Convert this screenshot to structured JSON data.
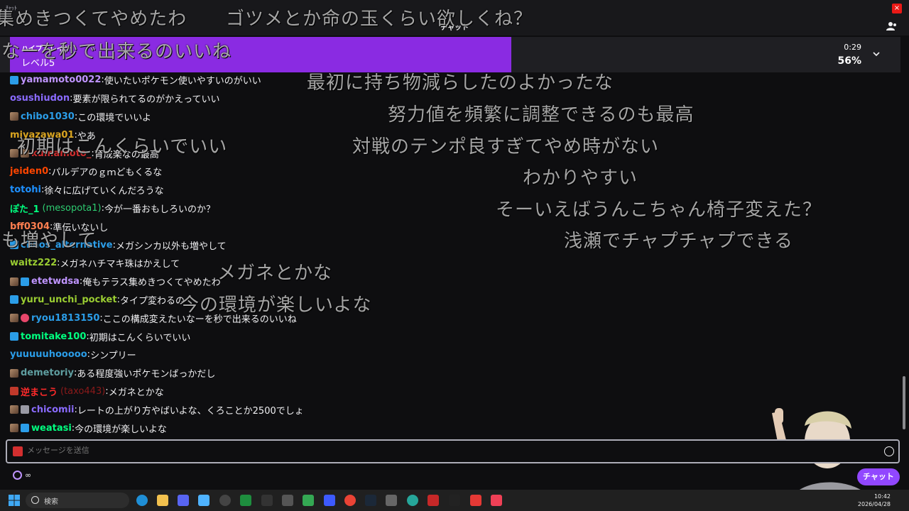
{
  "window": {
    "label": "ﾁｬｯﾄ",
    "close": "×"
  },
  "header": {
    "title": "チャット"
  },
  "hype_train": {
    "title": "ハイプトレイン",
    "level": "レベル5",
    "time": "0:29",
    "percent": "56%",
    "progress": 0.56,
    "accent": "#8a2be2"
  },
  "messages": [
    {
      "badges": [
        "blue"
      ],
      "user": "yamamoto0022",
      "color": "#bf94ff",
      "text": "使いたいポケモン使いやすいのがいい"
    },
    {
      "badges": [],
      "user": "osushiudon",
      "color": "#8a6bff",
      "text": "要素が限られてるのがかえっていい"
    },
    {
      "badges": [
        "img"
      ],
      "user": "chibo1030",
      "color": "#2b9de8",
      "text": "この環境でいいよ"
    },
    {
      "badges": [],
      "user": "miyazawa01",
      "color": "#daa520",
      "text": "やあ"
    },
    {
      "badges": [
        "img",
        "img"
      ],
      "user": "kumamoto_",
      "color": "#d32f2f",
      "text": "育成楽なの最高"
    },
    {
      "badges": [],
      "user": "jeiden0",
      "color": "#ff4500",
      "text": "パルデアのｇｍどもくるな"
    },
    {
      "badges": [],
      "user": "totohi",
      "color": "#1e90ff",
      "text": "徐々に広げていくんだろうな"
    },
    {
      "badges": [],
      "user": "ぽた_1",
      "sub": "(mesopota1)",
      "color": "#00ff7f",
      "text": "今が一番おもしろいのか？"
    },
    {
      "badges": [],
      "user": "bff0304",
      "color": "#ff7f50",
      "text": "準伝いないし"
    },
    {
      "badges": [
        "blue"
      ],
      "user": "chaos_alternative",
      "color": "#2b9de8",
      "text": "メガシンカ以外も増やして"
    },
    {
      "badges": [],
      "user": "waitz222",
      "color": "#9acd32",
      "text": "メガネハチマキ珠はかえして"
    },
    {
      "badges": [
        "img",
        "blue"
      ],
      "user": "etetwdsa",
      "color": "#bf94ff",
      "text": "俺もテラス集めきつくてやめたわ"
    },
    {
      "badges": [
        "blue"
      ],
      "user": "yuru_unchi_pocket",
      "color": "#9acd32",
      "text": "タイプ変わるの"
    },
    {
      "badges": [
        "img",
        "heart"
      ],
      "user": "ryou1813150",
      "color": "#2b9de8",
      "text": "ここの構成変えたいなーを秒で出来るのいいね"
    },
    {
      "badges": [
        "blue"
      ],
      "user": "tomitake100",
      "color": "#00ff7f",
      "text": "初期はこんくらいでいい"
    },
    {
      "badges": [],
      "user": "yuuuuuhooooo",
      "color": "#2b9de8",
      "text": "シンプリー"
    },
    {
      "badges": [
        "img"
      ],
      "user": "demetoriy",
      "color": "#5f9ea0",
      "text": "ある程度強いポケモンばっかだし"
    },
    {
      "badges": [
        "red"
      ],
      "user": "逆まこう",
      "sub_red": "(taxo443)",
      "color": "#ff2a2a",
      "text": "メガネとかな"
    },
    {
      "badges": [
        "img",
        "mute"
      ],
      "user": "chicomii",
      "color": "#8a6bff",
      "text": "レートの上がり方やばいよな、くろことか2500でしょ"
    },
    {
      "badges": [
        "img",
        "blue"
      ],
      "user": "weatasi",
      "color": "#00ff7f",
      "text": "今の環境が楽しいよな"
    }
  ],
  "comments": [
    {
      "id": "c1",
      "text": "集めきつくてやめたわ"
    },
    {
      "id": "c2",
      "text": "ゴツメとか命の玉くらい欲しくね？"
    },
    {
      "id": "c3",
      "text": "なーを秒で出来るのいいね"
    },
    {
      "id": "c4",
      "text": "最初に持ち物減らしたのよかったな"
    },
    {
      "id": "c5",
      "text": "努力値を頻繁に調整できるのも最高"
    },
    {
      "id": "c6",
      "text": "初期はこんくらいでいい"
    },
    {
      "id": "c7",
      "text": "対戦のテンポ良すぎてやめ時がない"
    },
    {
      "id": "c8",
      "text": "わかりやすい"
    },
    {
      "id": "c9",
      "text": "そーいえばうんこちゃん椅子変えた？"
    },
    {
      "id": "c10",
      "text": "も増やして"
    },
    {
      "id": "c11",
      "text": "浅瀬でチャプチャプできる"
    },
    {
      "id": "c12",
      "text": "メガネとかな"
    },
    {
      "id": "c13",
      "text": "今の環境が楽しいよな"
    }
  ],
  "input": {
    "placeholder": "メッセージを送信"
  },
  "footer": {
    "points": "∞",
    "chat_button": "チャット"
  },
  "taskbar": {
    "search_label": "検索",
    "time": "10:42",
    "date": "2026/04/28"
  }
}
